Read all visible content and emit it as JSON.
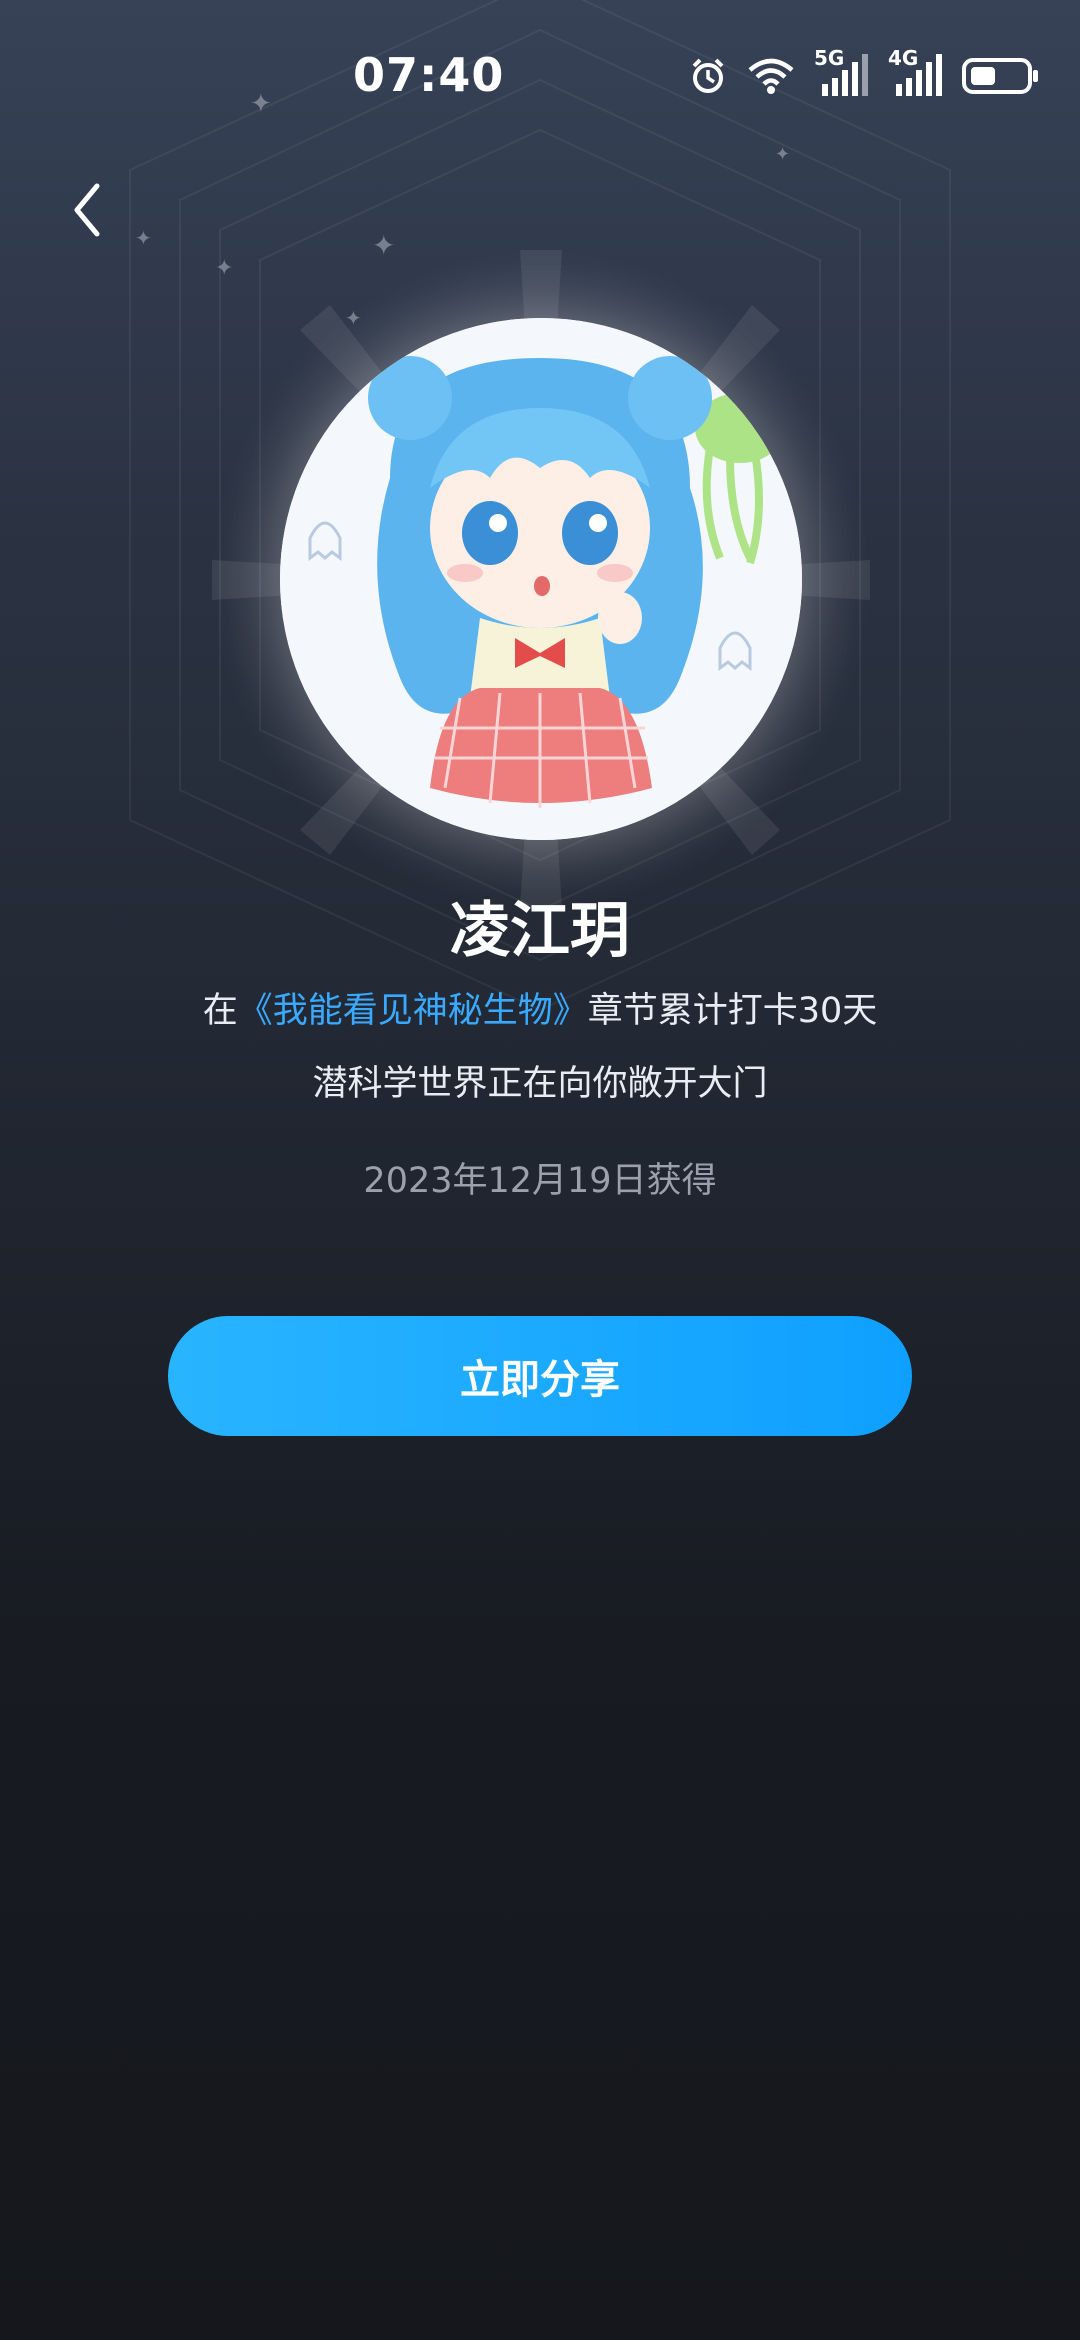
{
  "status_bar": {
    "time": "07:40",
    "network_1": "5G",
    "network_2": "4G",
    "icons": [
      "alarm-icon",
      "wifi-icon",
      "signal-5g-icon",
      "signal-4g-icon",
      "battery-icon"
    ]
  },
  "badge": {
    "name": "凌江玥",
    "desc_prefix": "在",
    "book_title": "《我能看见神秘生物》",
    "desc_suffix": "章节累计打卡30天",
    "subtitle": "潜科学世界正在向你敞开大门",
    "date": "2023年12月19日获得"
  },
  "actions": {
    "share_label": "立即分享"
  },
  "colors": {
    "accent": "#0fa0ff",
    "link": "#39a9ff"
  }
}
